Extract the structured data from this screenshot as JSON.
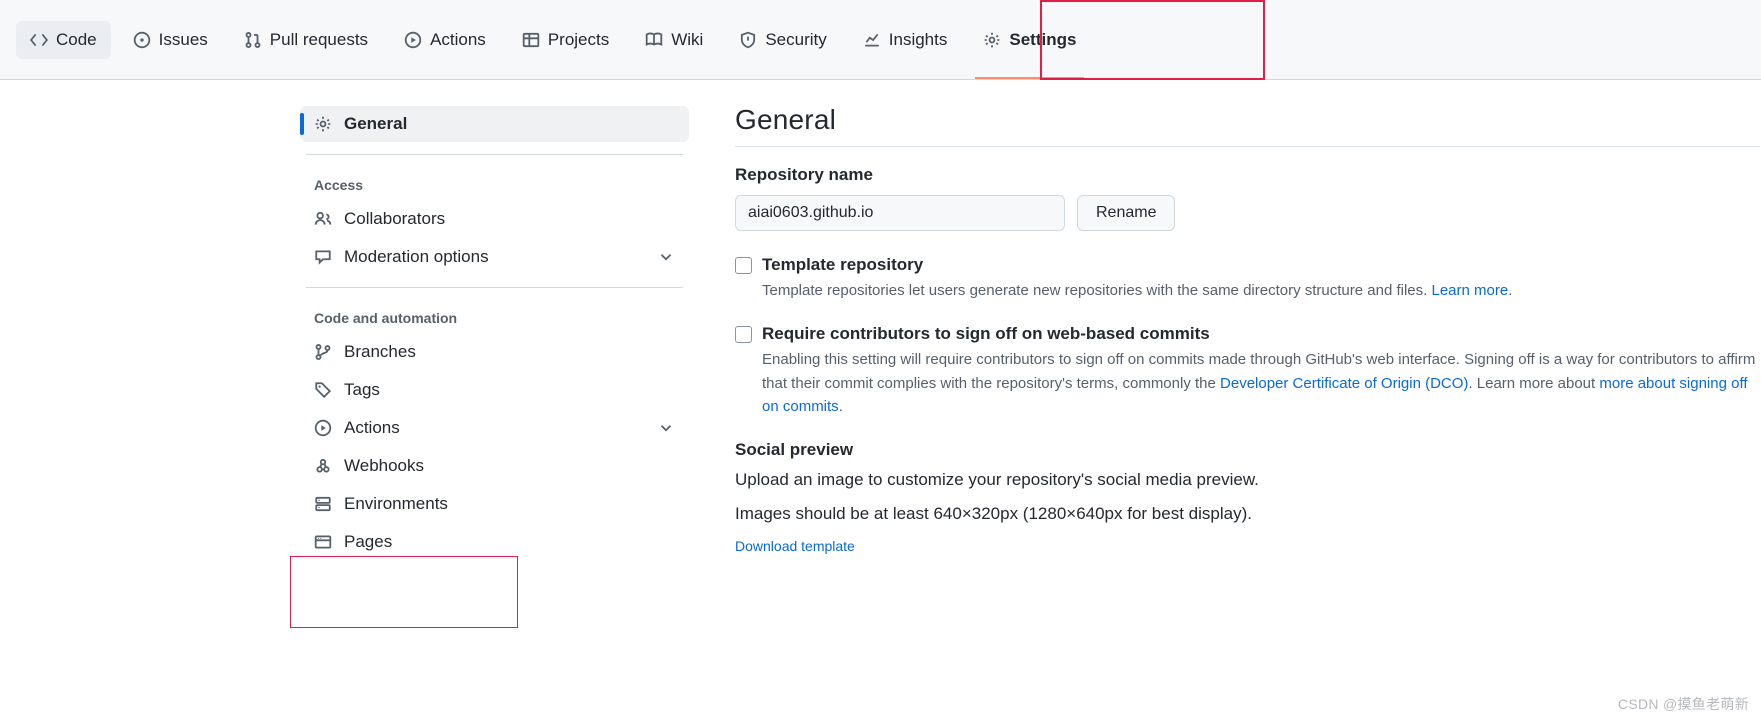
{
  "tabs": {
    "code": "Code",
    "issues": "Issues",
    "pulls": "Pull requests",
    "actions": "Actions",
    "projects": "Projects",
    "wiki": "Wiki",
    "security": "Security",
    "insights": "Insights",
    "settings": "Settings"
  },
  "sidebar": {
    "general": "General",
    "access_heading": "Access",
    "collaborators": "Collaborators",
    "moderation": "Moderation options",
    "code_heading": "Code and automation",
    "branches": "Branches",
    "tags": "Tags",
    "actions": "Actions",
    "webhooks": "Webhooks",
    "environments": "Environments",
    "pages": "Pages"
  },
  "content": {
    "heading": "General",
    "repo_name_label": "Repository name",
    "repo_name_value": "aiai0603.github.io",
    "rename_btn": "Rename",
    "template_label": "Template repository",
    "template_desc": "Template repositories let users generate new repositories with the same directory structure and files.",
    "template_link": "Learn more",
    "signoff_label": "Require contributors to sign off on web-based commits",
    "signoff_desc1": "Enabling this setting will require contributors to sign off on commits made through GitHub's web interface. Signing off is a way for contributors to affirm that their commit complies with the repository's terms, commonly the ",
    "signoff_link1": "Developer Certificate of Origin (DCO)",
    "signoff_desc2": ". Learn more about ",
    "signoff_link2": "more about signing off on commits",
    "social_heading": "Social preview",
    "social_desc1": "Upload an image to customize your repository's social media preview.",
    "social_desc2": "Images should be at least 640×320px (1280×640px for best display).",
    "download_template": "Download template"
  },
  "watermark": "CSDN @摸鱼老萌新"
}
